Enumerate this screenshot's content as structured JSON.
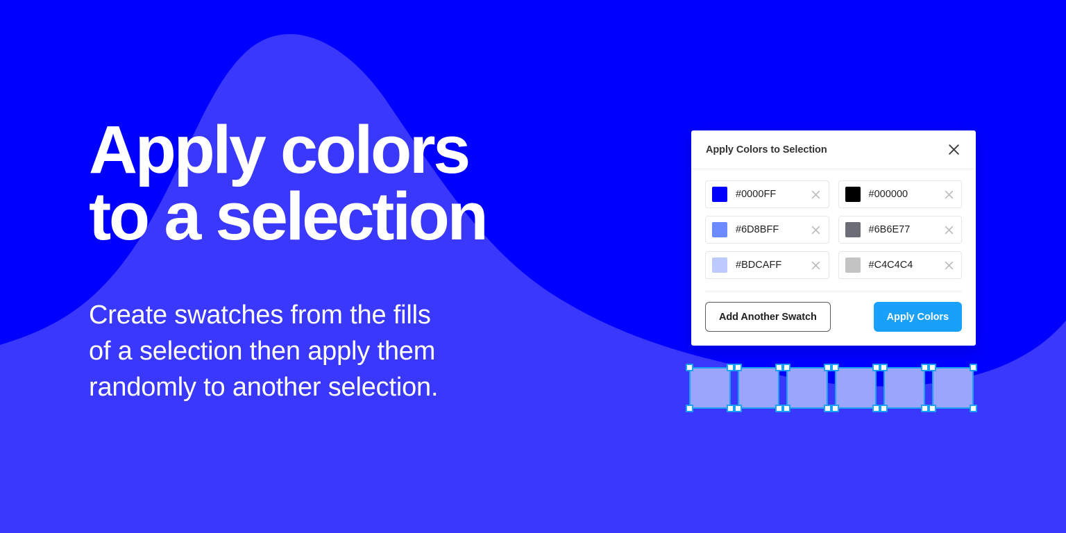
{
  "theme": {
    "background_base": "#0000FF",
    "background_wave": "#3B38FD",
    "accent_button": "#18A0FB",
    "selection_stroke": "#18A0FB",
    "selection_fill": "#9BA5FB",
    "panel_background": "#FFFFFF",
    "text_on_background": "#FFFFFF"
  },
  "hero": {
    "headline": "Apply colors\nto a selection",
    "subcopy": "Create swatches from the fills\nof a selection then apply them\nrandomly to another selection."
  },
  "panel": {
    "title": "Apply Colors to Selection",
    "close_icon": "close-icon",
    "swatches": [
      {
        "hex": "#0000FF",
        "color": "#0000FF",
        "remove_icon": "close-icon"
      },
      {
        "hex": "#000000",
        "color": "#000000",
        "remove_icon": "close-icon"
      },
      {
        "hex": "#6D8BFF",
        "color": "#6D8BFF",
        "remove_icon": "close-icon"
      },
      {
        "hex": "#6B6E77",
        "color": "#6B6E77",
        "remove_icon": "close-icon"
      },
      {
        "hex": "#BDCAFF",
        "color": "#BDCAFF",
        "remove_icon": "close-icon"
      },
      {
        "hex": "#C4C4C4",
        "color": "#C4C4C4",
        "remove_icon": "close-icon"
      }
    ],
    "add_swatch_label": "Add Another Swatch",
    "apply_colors_label": "Apply Colors"
  },
  "canvas": {
    "selection_count": 6,
    "rect_fill": "#9BA5FB",
    "rect_stroke": "#18A0FB"
  }
}
